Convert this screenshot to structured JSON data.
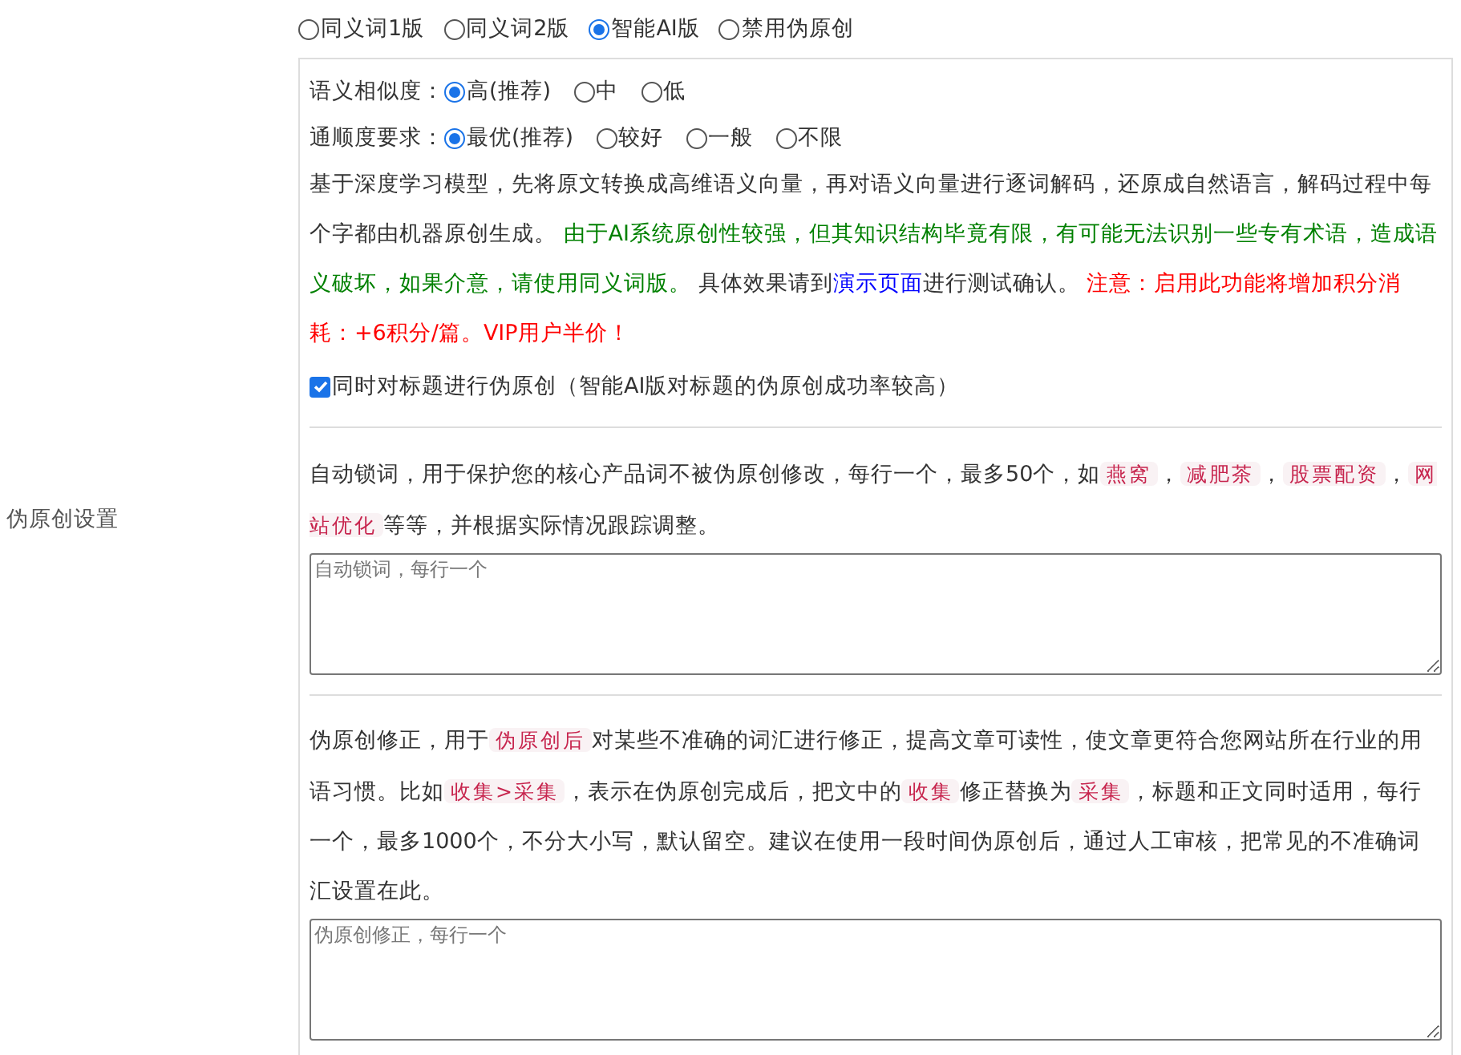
{
  "setting_label": "伪原创设置",
  "mode_options": [
    {
      "label": "同义词1版",
      "selected": false
    },
    {
      "label": "同义词2版",
      "selected": false
    },
    {
      "label": "智能AI版",
      "selected": true
    },
    {
      "label": "禁用伪原创",
      "selected": false
    }
  ],
  "similarity": {
    "label": "语义相似度：",
    "options": [
      {
        "label": "高(推荐)",
        "selected": true
      },
      {
        "label": "中",
        "selected": false
      },
      {
        "label": "低",
        "selected": false
      }
    ]
  },
  "fluency": {
    "label": "通顺度要求：",
    "options": [
      {
        "label": "最优(推荐)",
        "selected": true
      },
      {
        "label": "较好",
        "selected": false
      },
      {
        "label": "一般",
        "selected": false
      },
      {
        "label": "不限",
        "selected": false
      }
    ]
  },
  "description": [
    {
      "kind": "plain",
      "text": "基于深度学习模型，先将原文转换成高维语义向量，再对语义向量进行逐词解码，还原成自然语言，解码过程中每个字都由机器原创生成。 "
    },
    {
      "kind": "note",
      "text": "由于AI系统原创性较强，但其知识结构毕竟有限，有可能无法识别一些专有术语，造成语义破坏，如果介意，请使用同义词版。"
    },
    {
      "kind": "plain",
      "text": " 具体效果请到"
    },
    {
      "kind": "link",
      "text": "演示页面"
    },
    {
      "kind": "plain",
      "text": "进行测试确认。 "
    },
    {
      "kind": "warning",
      "text": "注意：启用此功能将增加积分消耗：+6积分/篇。VIP用户半价！"
    }
  ],
  "title_option": {
    "label": "同时对标题进行伪原创（智能AI版对标题的伪原创成功率较高）",
    "checked": true
  },
  "lock_words": {
    "text": [
      {
        "kind": "plain",
        "text": "自动锁词，用于保护您的核心产品词不被伪原创修改，每行一个，最多50个，如"
      },
      {
        "kind": "tag",
        "text": "燕窝"
      },
      {
        "kind": "plain",
        "text": "，"
      },
      {
        "kind": "tag",
        "text": "减肥茶"
      },
      {
        "kind": "plain",
        "text": "，"
      },
      {
        "kind": "tag",
        "text": "股票配资"
      },
      {
        "kind": "plain",
        "text": "，"
      },
      {
        "kind": "tag",
        "text": "网站优化"
      },
      {
        "kind": "plain",
        "text": "等等，并根据实际情况跟踪调整。"
      }
    ],
    "placeholder": "自动锁词，每行一个"
  },
  "correction": {
    "text": [
      {
        "kind": "plain",
        "text": "伪原创修正，用于"
      },
      {
        "kind": "tag",
        "text": "伪原创后"
      },
      {
        "kind": "plain",
        "text": "对某些不准确的词汇进行修正，提高文章可读性，使文章更符合您网站所在行业的用语习惯。比如"
      },
      {
        "kind": "tag",
        "text": "收集>采集"
      },
      {
        "kind": "plain",
        "text": "，表示在伪原创完成后，把文中的"
      },
      {
        "kind": "tag",
        "text": "收集"
      },
      {
        "kind": "plain",
        "text": "修正替换为"
      },
      {
        "kind": "tag",
        "text": "采集"
      },
      {
        "kind": "plain",
        "text": "，标题和正文同时适用，每行一个，最多1000个，不分大小写，默认留空。建议在使用一段时间伪原创后，通过人工审核，把常见的不准确词汇设置在此。"
      }
    ],
    "placeholder": "伪原创修正，每行一个"
  }
}
